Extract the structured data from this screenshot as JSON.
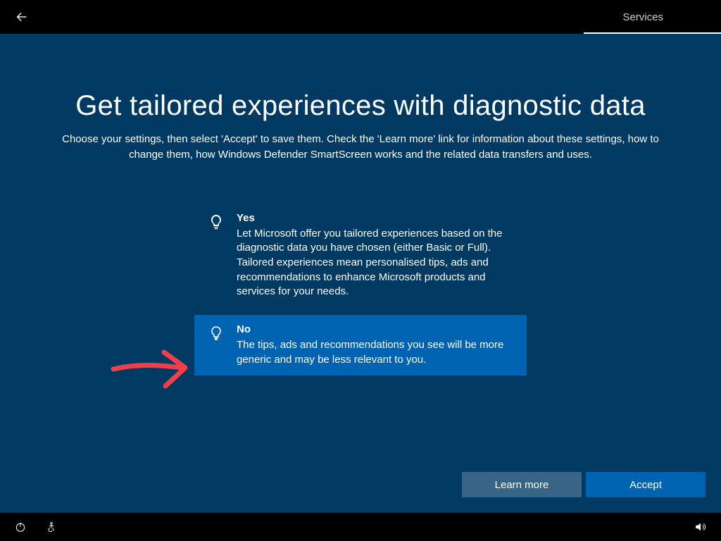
{
  "header": {
    "services_label": "Services"
  },
  "main": {
    "heading": "Get tailored experiences with diagnostic data",
    "subheading": "Choose your settings, then select 'Accept' to save them. Check the 'Learn more' link for information about these settings, how to change them, how Windows Defender SmartScreen works and the related data transfers and uses."
  },
  "options": [
    {
      "title": "Yes",
      "description": "Let Microsoft offer you tailored experiences based on the diagnostic data you have chosen (either Basic or Full). Tailored experiences mean personalised tips, ads and recommendations to enhance Microsoft products and services for your needs.",
      "selected": false
    },
    {
      "title": "No",
      "description": "The tips, ads and recommendations you see will be more generic and may be less relevant to you.",
      "selected": true
    }
  ],
  "buttons": {
    "learn_more": "Learn more",
    "accept": "Accept"
  },
  "colors": {
    "main_bg": "#003a63",
    "accent": "#0063b1",
    "annotation": "#ef3f4a"
  }
}
